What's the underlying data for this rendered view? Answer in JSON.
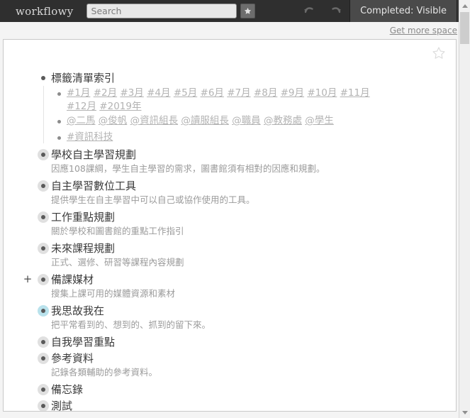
{
  "header": {
    "brand": "workflowy",
    "search_placeholder": "Search",
    "search_value": "",
    "star_icon": "star-filled-icon",
    "undo_icon": "undo-arrow-icon",
    "redo_icon": "redo-arrow-icon",
    "completed_label": "Completed: Visible"
  },
  "subbar": {
    "get_more_space": "Get more space"
  },
  "card": {
    "star_icon": "star-outline-icon"
  },
  "outline": {
    "items": [
      {
        "name": "標籤清單索引",
        "note": "",
        "bullet": "plain",
        "children": [
          {
            "name": "#1月 #2月 #3月 #4月 #5月 #6月 #7月 #8月 #9月 #10月 #11月 #12月 #2019年",
            "tags": [
              "#1月",
              "#2月",
              "#3月",
              "#4月",
              "#5月",
              "#6月",
              "#7月",
              "#8月",
              "#9月",
              "#10月",
              "#11月",
              "#12月",
              "#2019年"
            ],
            "bullet": "plain"
          },
          {
            "name": "@二馬 @俊帆 @資訊組長 @讀服組長 @職員 @教務處 @學生",
            "tags": [
              "@二馬",
              "@俊帆",
              "@資訊組長",
              "@讀服組長",
              "@職員",
              "@教務處",
              "@學生"
            ],
            "bullet": "plain"
          },
          {
            "name": "#資訊科技",
            "tags": [
              "#資訊科技"
            ],
            "bullet": "plain"
          }
        ]
      },
      {
        "name": "學校自主學習規劃",
        "note": "因應108課綱，學生自主學習的需求，圖書館須有相對的因應和規劃。",
        "bullet": "collapsed"
      },
      {
        "name": "自主學習數位工具",
        "note": "提供學生在自主學習中可以自己或協作使用的工具。",
        "bullet": "collapsed"
      },
      {
        "name": "工作重點規劃",
        "note": "關於學校和圖書館的重點工作指引",
        "bullet": "collapsed"
      },
      {
        "name": "未來課程規劃",
        "note": "正式、選修、研習等課程內容規劃",
        "bullet": "collapsed"
      },
      {
        "name": "備課媒材",
        "note": "搜集上課可用的媒體資源和素材",
        "bullet": "collapsed",
        "plus_handle": "+"
      },
      {
        "name": "我思故我在",
        "note": "把平常看到的、想到的、抓到的留下來。",
        "bullet": "collapsed-highlight"
      },
      {
        "name": "自我學習重點",
        "note": "",
        "bullet": "collapsed"
      },
      {
        "name": "參考資料",
        "note": "記錄各類輔助的參考資料。",
        "bullet": "collapsed"
      },
      {
        "name": "備忘錄",
        "note": "",
        "bullet": "collapsed"
      },
      {
        "name": "測試",
        "note": "",
        "bullet": "collapsed"
      }
    ]
  },
  "scrollbar": {
    "up_icon": "triangle-up-icon",
    "down_icon": "triangle-down-icon"
  },
  "colors": {
    "header_bg": "#2f2f2f",
    "completed_bg": "#4a4a4a",
    "highlight_bullet": "#b9e2ec",
    "text": "#3a3a3a",
    "muted": "#9b9b9b",
    "tag": "#b3b3b3"
  }
}
